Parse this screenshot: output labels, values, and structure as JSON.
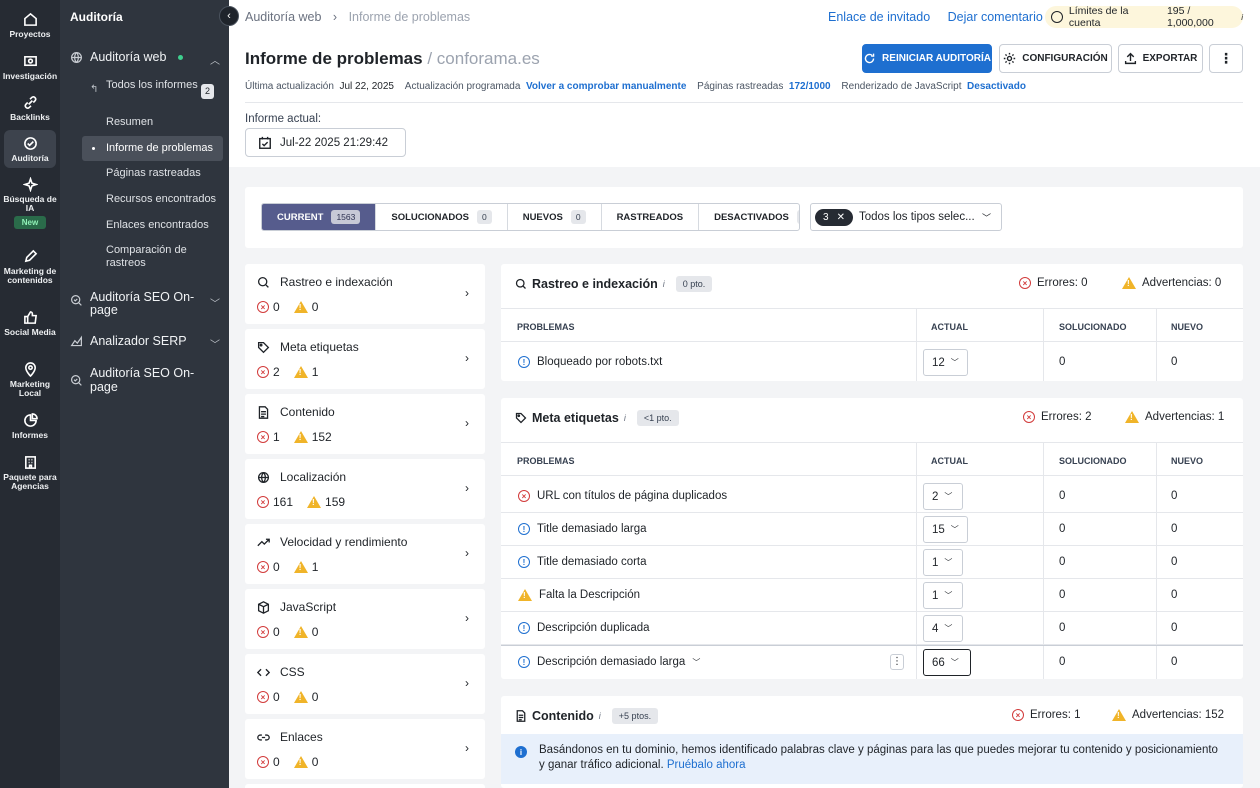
{
  "rail": [
    {
      "label": "Proyectos",
      "icon": "home-icon"
    },
    {
      "label": "Investigación",
      "icon": "research-icon"
    },
    {
      "label": "Backlinks",
      "icon": "link-icon"
    },
    {
      "label": "Auditoría",
      "icon": "audit-icon"
    },
    {
      "label": "Búsqueda de IA",
      "icon": "sparkle-icon",
      "badge": "New"
    },
    {
      "label": "Marketing de contenidos",
      "icon": "edit-icon"
    },
    {
      "label": "Social Media",
      "icon": "thumb-icon"
    },
    {
      "label": "Marketing Local",
      "icon": "pin-icon"
    },
    {
      "label": "Informes",
      "icon": "pie-icon"
    },
    {
      "label": "Paquete para Agencias",
      "icon": "building-icon"
    }
  ],
  "nav": {
    "title": "Auditoría",
    "group_web": "Auditoría web",
    "items": [
      "Todos los informes",
      "Resumen",
      "Informe de problemas",
      "Páginas rastreadas",
      "Recursos encontrados",
      "Enlaces encontrados",
      "Comparación de rastreos"
    ],
    "all_count": "2",
    "group_onpage": "Auditoría SEO On-page",
    "group_serp": "Analizador SERP",
    "group_onpage2": "Auditoría SEO On-page"
  },
  "header": {
    "crumb1": "Auditoría web",
    "crumb2": "Informe de problemas",
    "invite": "Enlace de invitado",
    "comment": "Dejar comentario",
    "limit_label": "Límites de la cuenta",
    "limit_value": "195 / 1,000,000",
    "title": "Informe de problemas",
    "domain": "/ conforama.es",
    "restart": "REINICIAR AUDITORÍA",
    "config": "CONFIGURACIÓN",
    "export": "EXPORTAR",
    "last_update_label": "Última actualización",
    "last_update": "Jul 22, 2025",
    "scheduled_label": "Actualización programada",
    "scheduled_link": "Volver a comprobar manualmente",
    "crawled_label": "Páginas rastreadas",
    "crawled": "172/1000",
    "js_label": "Renderizado de JavaScript",
    "js": "Desactivado",
    "current_label": "Informe actual:",
    "current_date": "Jul-22 2025 21:29:42"
  },
  "filters": {
    "tabs": [
      {
        "label": "CURRENT",
        "count": "1563"
      },
      {
        "label": "SOLUCIONADOS",
        "count": "0"
      },
      {
        "label": "NUEVOS",
        "count": "0"
      },
      {
        "label": "RASTREADOS",
        "count": ""
      },
      {
        "label": "DESACTIVADOS",
        "count": "0"
      }
    ],
    "type_count": "3",
    "type_label": "Todos los tipos selec..."
  },
  "categories": [
    {
      "name": "Rastreo e indexación",
      "icon": "search-icon",
      "errors": "0",
      "warnings": "0"
    },
    {
      "name": "Meta etiquetas",
      "icon": "tag-icon",
      "errors": "2",
      "warnings": "1"
    },
    {
      "name": "Contenido",
      "icon": "document-icon",
      "errors": "1",
      "warnings": "152"
    },
    {
      "name": "Localización",
      "icon": "globe-icon",
      "errors": "161",
      "warnings": "159"
    },
    {
      "name": "Velocidad y rendimiento",
      "icon": "trend-icon",
      "errors": "0",
      "warnings": "1"
    },
    {
      "name": "JavaScript",
      "icon": "cube-icon",
      "errors": "0",
      "warnings": "0"
    },
    {
      "name": "CSS",
      "icon": "code-icon",
      "errors": "0",
      "warnings": "0"
    },
    {
      "name": "Enlaces",
      "icon": "link-icon",
      "errors": "0",
      "warnings": "0"
    }
  ],
  "table_headers": {
    "problems": "PROBLEMAS",
    "current": "ACTUAL",
    "fixed": "SOLUCIONADO",
    "new": "NUEVO"
  },
  "sections": {
    "crawl": {
      "title": "Rastreo e indexación",
      "pts": "0 pto.",
      "errors_label": "Errores: 0",
      "warnings_label": "Advertencias: 0",
      "rows": [
        {
          "name": "Bloqueado por robots.txt",
          "current": "12",
          "fixed": "0",
          "new": "0"
        }
      ]
    },
    "meta": {
      "title": "Meta etiquetas",
      "pts": "<1 pto.",
      "errors_label": "Errores: 2",
      "warnings_label": "Advertencias: 1",
      "rows": [
        {
          "name": "URL con títulos de página duplicados",
          "current": "2",
          "fixed": "0",
          "new": "0"
        },
        {
          "name": "Title demasiado larga",
          "current": "15",
          "fixed": "0",
          "new": "0"
        },
        {
          "name": "Title demasiado corta",
          "current": "1",
          "fixed": "0",
          "new": "0"
        },
        {
          "name": "Falta la Descripción",
          "current": "1",
          "fixed": "0",
          "new": "0"
        },
        {
          "name": "Descripción duplicada",
          "current": "4",
          "fixed": "0",
          "new": "0"
        },
        {
          "name": "Descripción demasiado larga",
          "current": "66",
          "fixed": "0",
          "new": "0"
        }
      ]
    },
    "content": {
      "title": "Contenido",
      "pts": "+5 ptos.",
      "errors_label": "Errores: 1",
      "warnings_label": "Advertencias: 152",
      "banner": "Basándonos en tu dominio, hemos identificado palabras clave y páginas para las que puedes mejorar tu contenido y posicionamiento y ganar tráfico adicional.",
      "banner_link": "Pruébalo ahora"
    }
  },
  "colors": {
    "accent": "#1e6fd0",
    "error": "#d23b3b",
    "warning": "#f0b429",
    "rail": "#262b33",
    "nav": "#2f353e",
    "tab_active": "#565c8d"
  }
}
